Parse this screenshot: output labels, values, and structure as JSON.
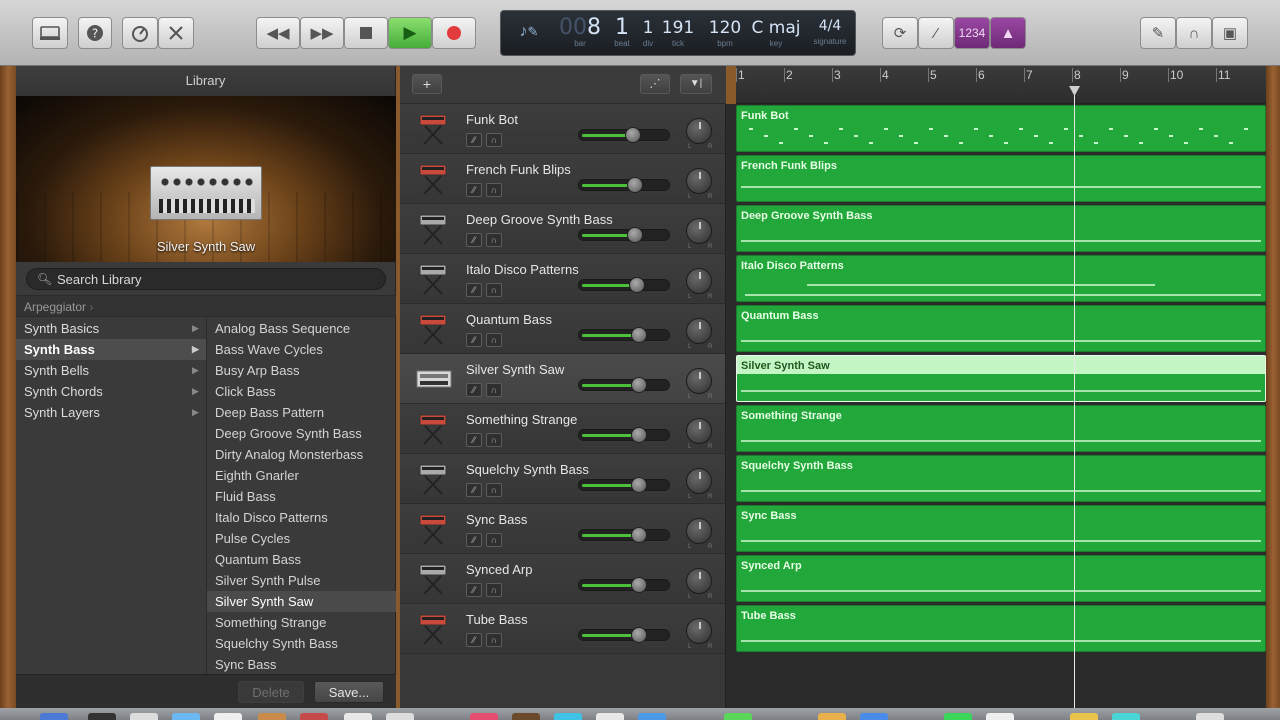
{
  "lcd": {
    "bar": "8",
    "beat": "1",
    "div": "1",
    "tick": "191",
    "bpm": "120",
    "key": "C maj",
    "signature": "4/4",
    "labels": {
      "bar": "bar",
      "beat": "beat",
      "div": "div",
      "tick": "tick",
      "bpm": "bpm",
      "key": "key",
      "signature": "signature"
    },
    "zero_prefix": "00"
  },
  "toolbar": {
    "count_in": "1234"
  },
  "library": {
    "title": "Library",
    "selected_patch": "Silver Synth Saw",
    "search_placeholder": "Search Library",
    "breadcrumb": "Arpeggiator",
    "categories": [
      {
        "label": "Synth Basics",
        "selected": false
      },
      {
        "label": "Synth Bass",
        "selected": true
      },
      {
        "label": "Synth Bells",
        "selected": false
      },
      {
        "label": "Synth Chords",
        "selected": false
      },
      {
        "label": "Synth Layers",
        "selected": false
      }
    ],
    "patches": [
      "Analog Bass Sequence",
      "Bass Wave Cycles",
      "Busy Arp Bass",
      "Click Bass",
      "Deep Bass Pattern",
      "Deep Groove Synth Bass",
      "Dirty Analog Monsterbass",
      "Eighth Gnarler",
      "Fluid Bass",
      "Italo Disco Patterns",
      "Pulse Cycles",
      "Quantum Bass",
      "Silver Synth Pulse",
      "Silver Synth Saw",
      "Something Strange",
      "Squelchy Synth Bass",
      "Sync Bass"
    ],
    "delete_label": "Delete",
    "save_label": "Save..."
  },
  "tracks": [
    {
      "name": "Funk Bot",
      "volume": 0.6
    },
    {
      "name": "French Funk Blips",
      "volume": 0.62
    },
    {
      "name": "Deep Groove Synth Bass",
      "volume": 0.63
    },
    {
      "name": "Italo Disco Patterns",
      "volume": 0.65
    },
    {
      "name": "Quantum Bass",
      "volume": 0.67
    },
    {
      "name": "Silver Synth Saw",
      "volume": 0.67,
      "selected": true
    },
    {
      "name": "Something Strange",
      "volume": 0.68
    },
    {
      "name": "Squelchy Synth Bass",
      "volume": 0.68
    },
    {
      "name": "Sync Bass",
      "volume": 0.68
    },
    {
      "name": "Synced Arp",
      "volume": 0.68
    },
    {
      "name": "Tube Bass",
      "volume": 0.68
    }
  ],
  "ruler": {
    "bars": [
      "1",
      "2",
      "3",
      "4",
      "5",
      "6",
      "7",
      "8",
      "9",
      "10",
      "11"
    ]
  },
  "colors": {
    "region": "#22a83a",
    "region_selected": "#c4f5c4",
    "play": "#46ad3a",
    "record": "#e23b3b",
    "count_in_bg": "#7a2e82"
  }
}
